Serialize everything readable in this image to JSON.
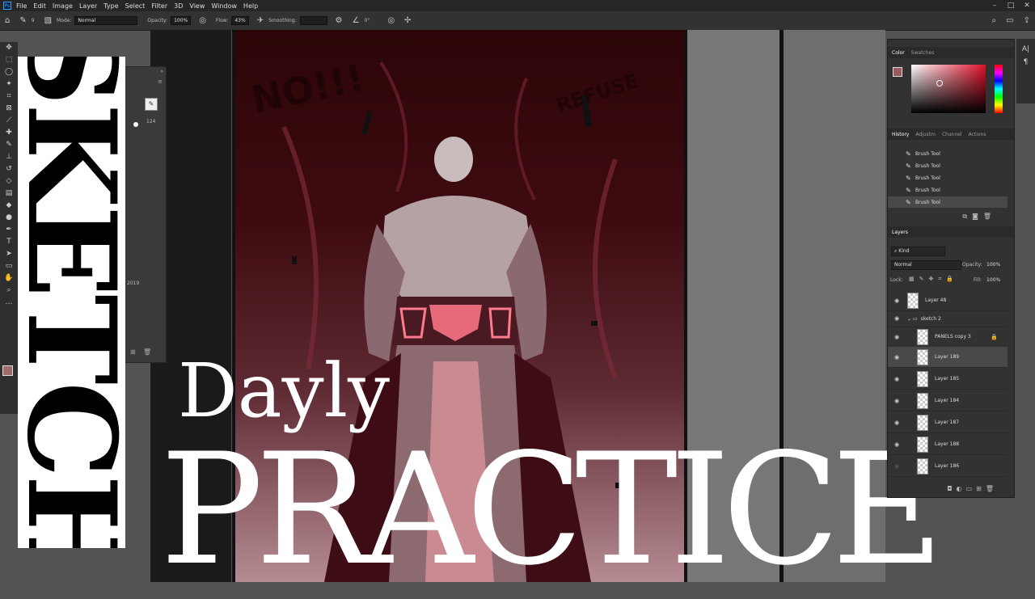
{
  "menu": {
    "items": [
      "File",
      "Edit",
      "Image",
      "Layer",
      "Type",
      "Select",
      "Filter",
      "3D",
      "View",
      "Window",
      "Help"
    ]
  },
  "options": {
    "brush_size": "9",
    "mode_label": "Mode:",
    "mode_value": "Normal",
    "opacity_label": "Opacity:",
    "opacity_value": "100%",
    "flow_label": "Flow:",
    "flow_value": "43%",
    "smoothing_label": "Smoothing:",
    "angle_value": "0°"
  },
  "brush_panel": {
    "size_value": "124",
    "year_text": "2019"
  },
  "overlay": {
    "sketch": "SKETCH",
    "dayly": "Dayly",
    "practice": "PRACTICE"
  },
  "color_panel": {
    "tabs": [
      "Color",
      "Swatches"
    ],
    "fg_color": "#9c5a60"
  },
  "history_panel": {
    "tabs": [
      "History",
      "Adjustm",
      "Channel",
      "Actions"
    ],
    "items": [
      "Brush Tool",
      "Brush Tool",
      "Brush Tool",
      "Brush Tool",
      "Brush Tool"
    ]
  },
  "layers_panel": {
    "tab": "Layers",
    "filter": "Kind",
    "blend_mode": "Normal",
    "opacity_label": "Opacity:",
    "opacity_value": "100%",
    "lock_label": "Lock:",
    "fill_label": "Fill:",
    "fill_value": "100%",
    "layers": [
      {
        "name": "Layer 48"
      },
      {
        "name": "sketch 2"
      },
      {
        "name": "PANELS copy 3"
      },
      {
        "name": "Layer 189"
      },
      {
        "name": "Layer 185"
      },
      {
        "name": "Layer 184"
      },
      {
        "name": "Layer 187"
      },
      {
        "name": "Layer 188"
      },
      {
        "name": "Layer 186"
      }
    ]
  },
  "art_text": {
    "shout_left": "NO!!!",
    "shout_right": "REFUSE"
  }
}
